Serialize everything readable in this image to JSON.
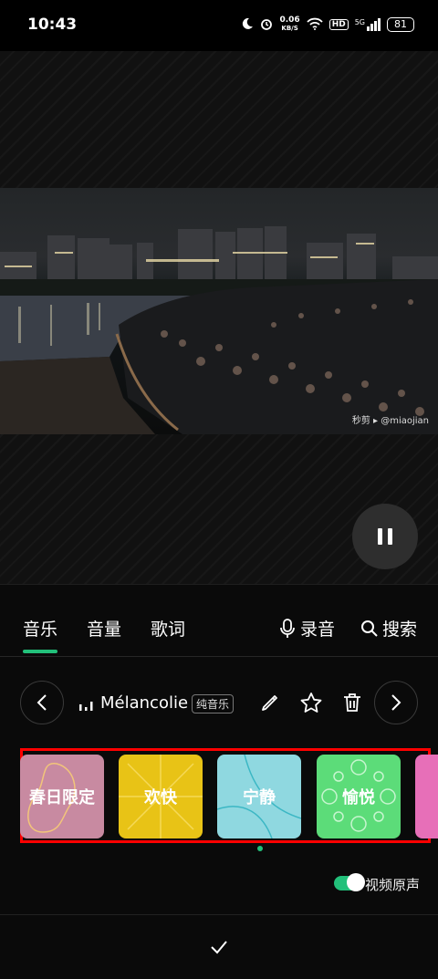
{
  "status_bar": {
    "time": "10:43",
    "speed_value": "0.06",
    "speed_unit": "KB/S",
    "hd_label": "HD",
    "network_label": "5G",
    "battery": "81"
  },
  "video": {
    "watermark": "秒剪 ▸ @miaojian"
  },
  "tabs": {
    "music": "音乐",
    "volume": "音量",
    "lyrics": "歌词",
    "record": "录音",
    "search": "搜索",
    "active": "music"
  },
  "music_row": {
    "track_name": "Mélancolie",
    "badge": "纯音乐"
  },
  "mood_cards": [
    {
      "label": "春日限定",
      "color": "#c88aa1"
    },
    {
      "label": "欢快",
      "color": "#e8c316"
    },
    {
      "label": "宁静",
      "color": "#8fd8e0"
    },
    {
      "label": "愉悦",
      "color": "#5cdc79"
    },
    {
      "label": "",
      "color": "#e76fb8"
    }
  ],
  "toggle": {
    "label": "视频原声",
    "on": true,
    "accent": "#22c07a"
  }
}
